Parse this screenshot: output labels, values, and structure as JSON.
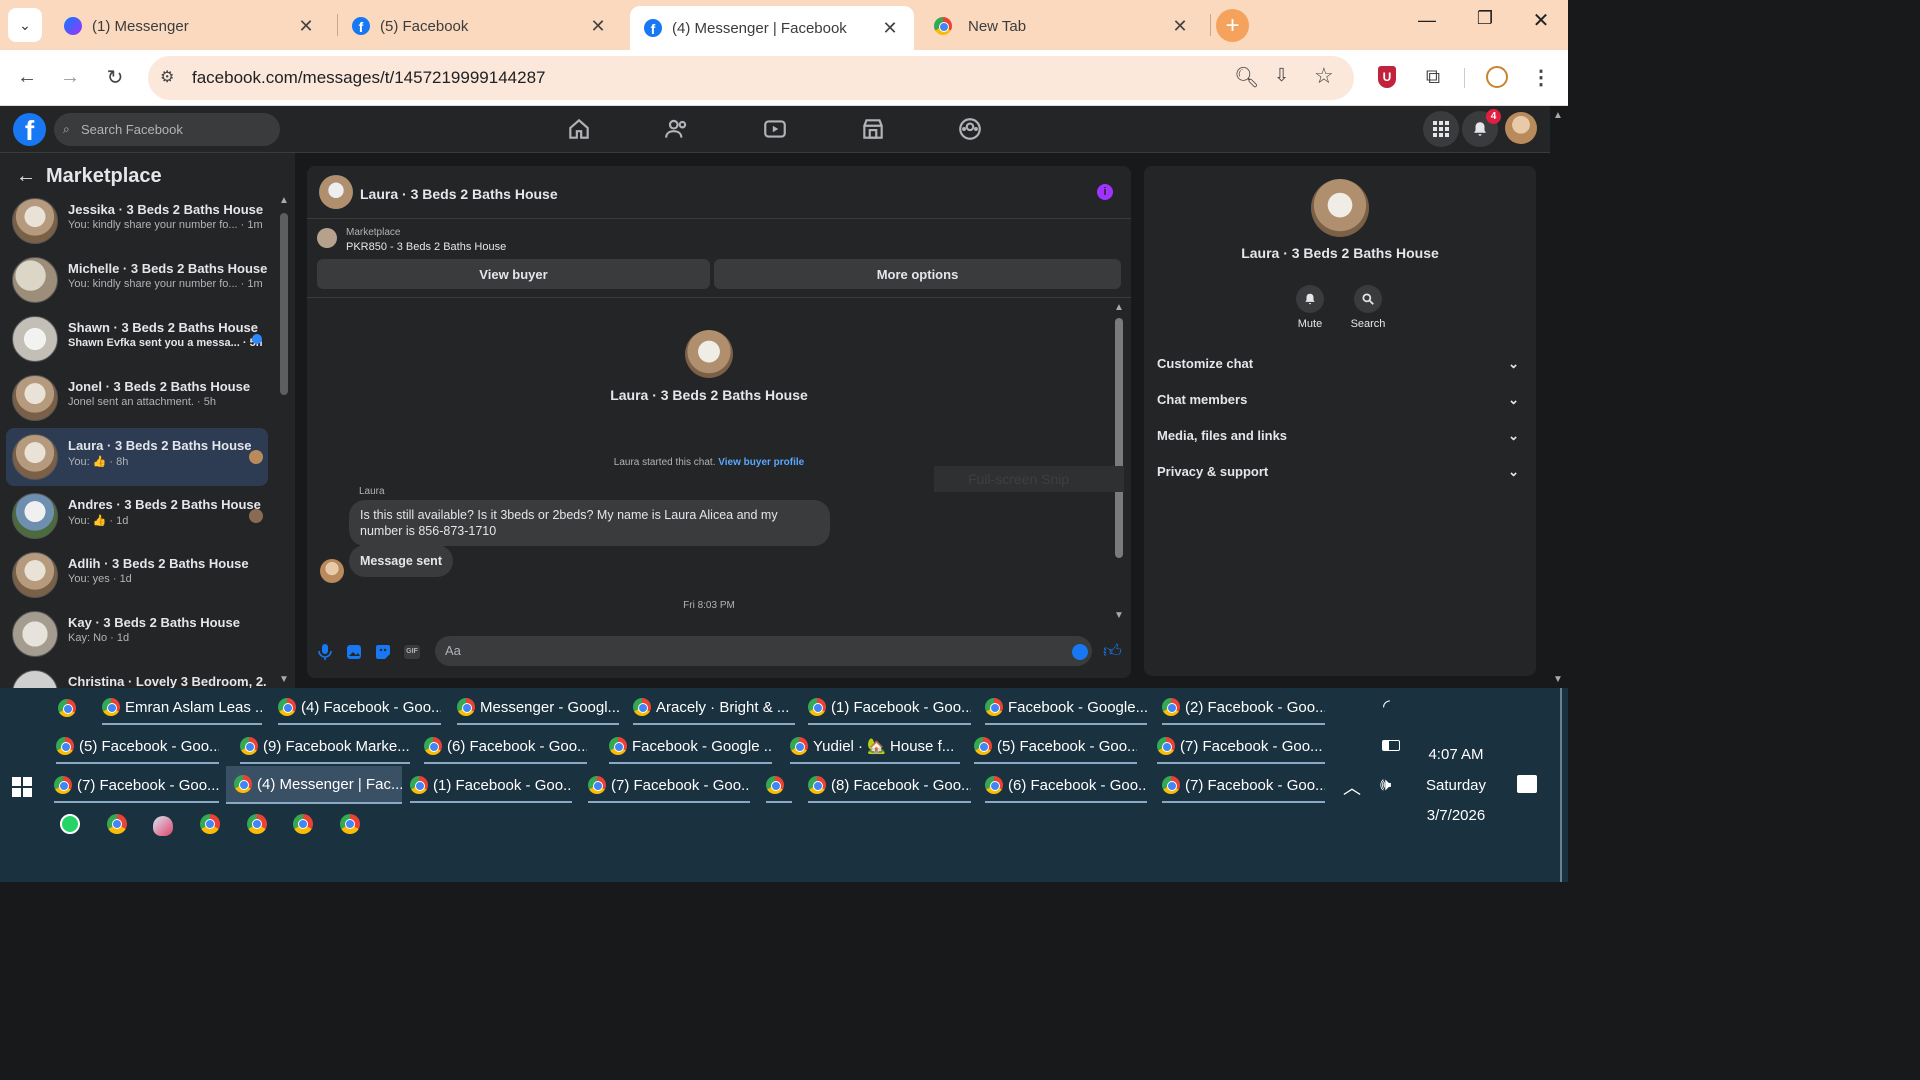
{
  "browser": {
    "tabs": [
      {
        "title": "(1) Messenger",
        "icon": "messenger-icon"
      },
      {
        "title": "(5) Facebook",
        "icon": "facebook-icon"
      },
      {
        "title": "(4) Messenger | Facebook",
        "icon": "facebook-icon",
        "active": true
      },
      {
        "title": "New Tab",
        "icon": "chrome-icon"
      }
    ],
    "url": "facebook.com/messages/t/1457219999144287"
  },
  "fb": {
    "search_placeholder": "Search Facebook",
    "notification_count": "4"
  },
  "left": {
    "title": "Marketplace",
    "conversations": [
      {
        "name": "Jessika · 3 Beds 2 Baths House",
        "preview": "You: kindly share your number fo... · 1m"
      },
      {
        "name": "Michelle · 3 Beds 2 Baths House",
        "preview": "You: kindly share your number fo... · 1m"
      },
      {
        "name": "Shawn · 3 Beds 2 Baths House",
        "preview": "Shawn Evfka sent you a messa... · 5h",
        "unread": true
      },
      {
        "name": "Jonel · 3 Beds 2 Baths House",
        "preview": "Jonel sent an attachment. · 5h"
      },
      {
        "name": "Laura · 3 Beds 2 Baths House",
        "preview": "You: 👍 · 8h",
        "selected": true
      },
      {
        "name": "Andres · 3 Beds 2 Baths House",
        "preview": "You: 👍 · 1d"
      },
      {
        "name": "Adlih · 3 Beds 2 Baths House",
        "preview": "You: yes · 1d"
      },
      {
        "name": "Kay · 3 Beds 2 Baths House",
        "preview": "Kay: No · 1d"
      },
      {
        "name": "Christina · Lovely 3 Bedroom, 2...",
        "preview": ""
      }
    ]
  },
  "chat": {
    "header_title": "Laura · 3 Beds 2 Baths House",
    "marketplace_label": "Marketplace",
    "listing": "PKR850 - 3 Beds 2 Baths House",
    "view_buyer": "View buyer",
    "more_options": "More options",
    "profile_name": "Laura · 3 Beds 2 Baths House",
    "started_text": "Laura started this chat.",
    "view_buyer_profile": "View buyer profile",
    "snip_text": "Full-screen Snip",
    "sender": "Laura",
    "message1": "Is this still available? Is it 3beds or 2beds? My name is Laura Alicea and my number is 856-873-1710",
    "message2": "Message sent",
    "timestamp": "Fri 8:03 PM",
    "composer_placeholder": "Aa"
  },
  "right": {
    "name": "Laura · 3 Beds 2 Baths House",
    "mute": "Mute",
    "search": "Search",
    "sections": [
      "Customize chat",
      "Chat members",
      "Media, files and links",
      "Privacy & support"
    ]
  },
  "taskbar": {
    "row1": [
      "Emran Aslam Leas ...",
      "(4) Facebook - Goo...",
      "Messenger - Googl...",
      "Aracely · Bright & ...",
      "(1) Facebook - Goo...",
      "Facebook - Google...",
      "(2) Facebook - Goo..."
    ],
    "row2": [
      "(5) Facebook - Goo...",
      "(9) Facebook Marke...",
      "(6) Facebook - Goo...",
      "Facebook - Google ...",
      "Yudiel · 🏡 House f...",
      "(5) Facebook - Goo...",
      "(7) Facebook - Goo..."
    ],
    "row3": [
      "(7) Facebook - Goo...",
      "(4) Messenger | Fac...",
      "(1) Facebook - Goo...",
      "(7) Facebook - Goo...",
      "",
      "(8) Facebook - Goo...",
      "(6) Facebook - Goo...",
      "(7) Facebook - Goo..."
    ],
    "time": "4:07 AM",
    "day": "Saturday",
    "date": "3/7/2026"
  },
  "colors": {
    "accent": "#1877f2",
    "messenger_purple": "#a033ff"
  }
}
